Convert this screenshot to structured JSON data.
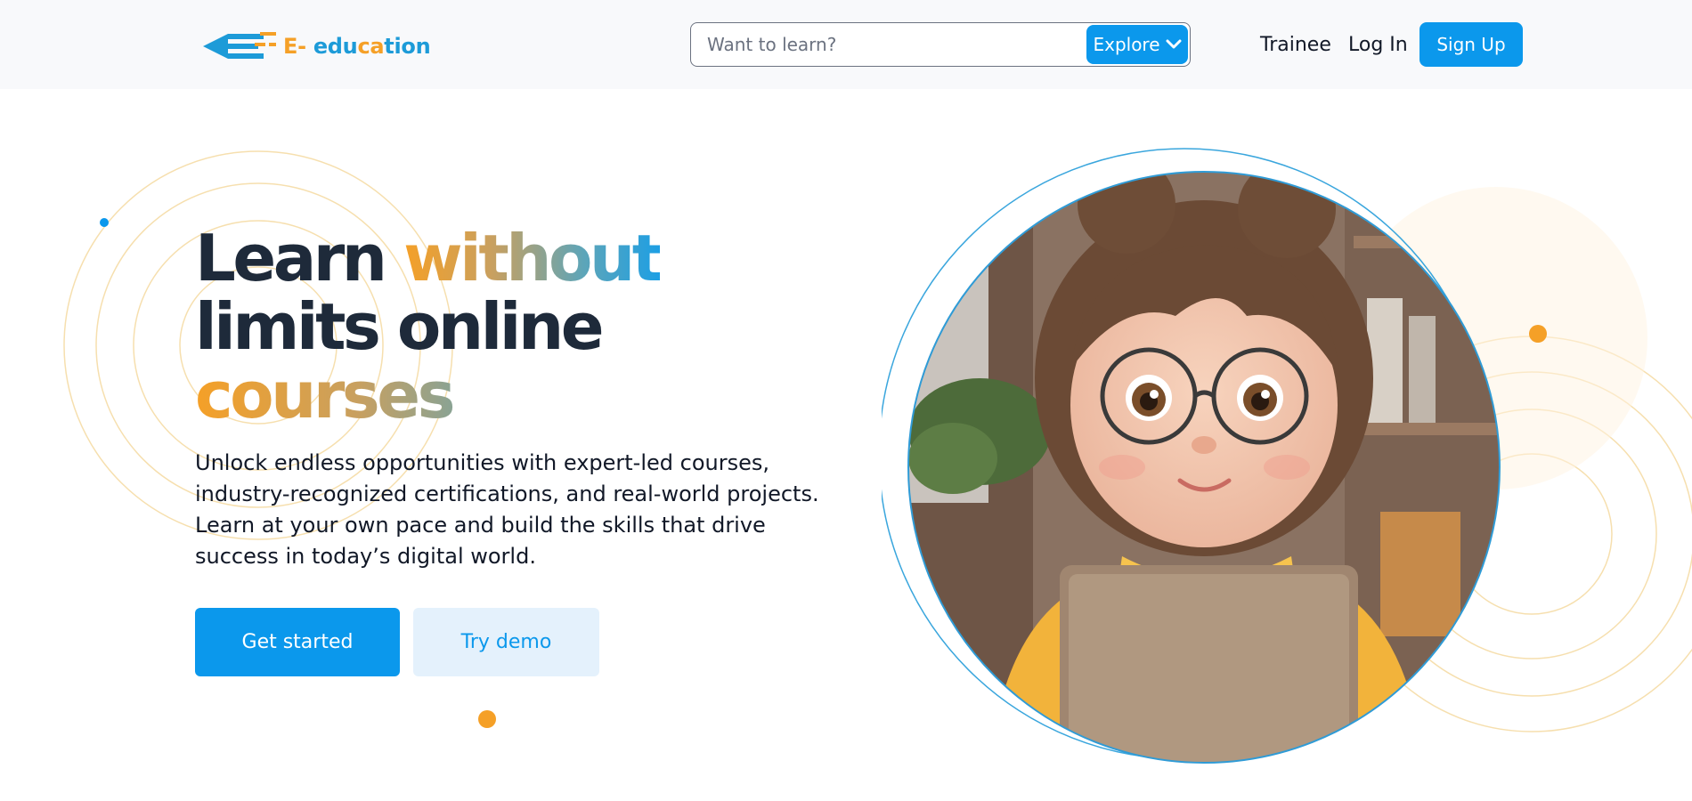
{
  "header": {
    "logo_text": {
      "e": "E-",
      "edu": " edu",
      "ca": "ca",
      "tion": "tion"
    },
    "search": {
      "placeholder": "Want to learn?",
      "value": ""
    },
    "explore_label": "Explore",
    "nav": {
      "trainee": "Trainee",
      "login": "Log In",
      "signup": "Sign Up"
    }
  },
  "hero": {
    "headline": {
      "line1_dark": "Learn ",
      "line1_grad": "without",
      "line2": "limits online",
      "line3": "courses"
    },
    "description": "Unlock endless opportunities with expert-led courses, industry-recognized certifications, and real-world projects. Learn at your own pace and build the skills that drive success in today’s digital world.",
    "buttons": {
      "primary": "Get started",
      "secondary": "Try demo"
    }
  },
  "colors": {
    "primary": "#0b98ec",
    "accent_orange": "#f5a027",
    "dark_text": "#1e2a3a",
    "header_bg": "#f8f9fb"
  },
  "icons": [
    "logo-pen-icon",
    "chevron-down-icon"
  ]
}
